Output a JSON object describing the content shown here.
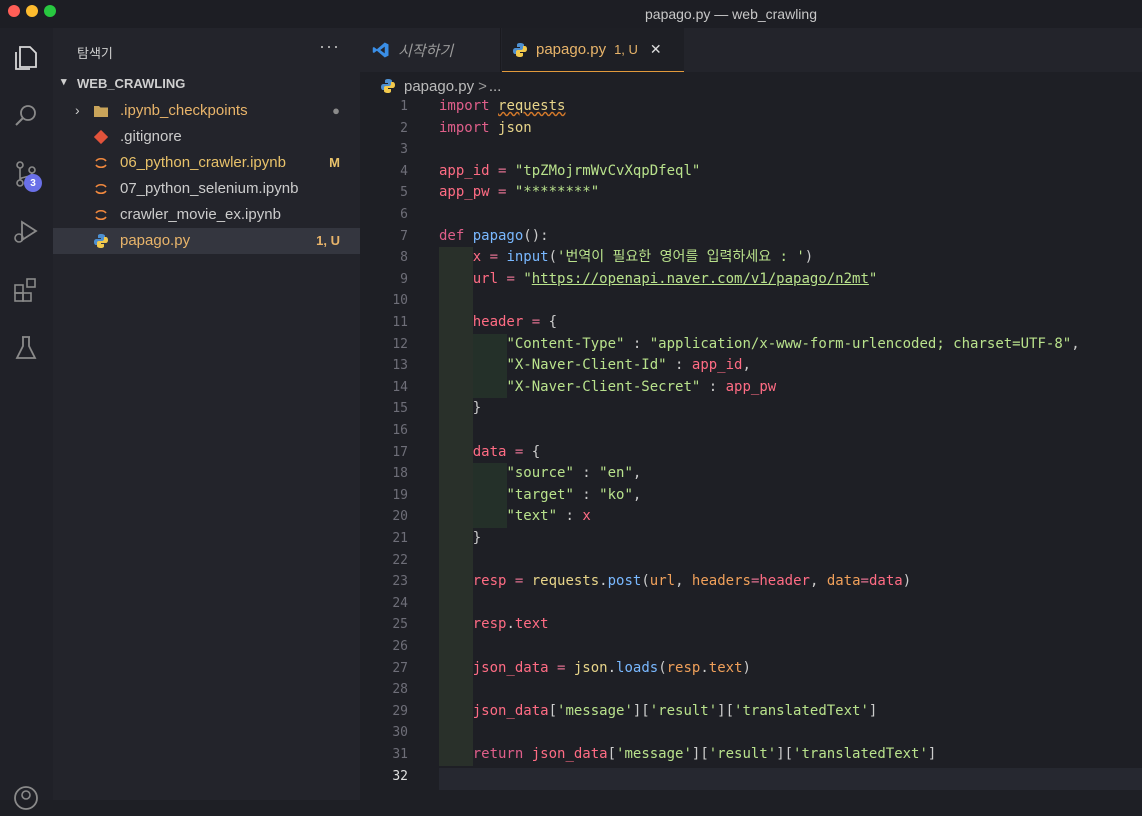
{
  "window": {
    "title": "papago.py — web_crawling"
  },
  "activity_bar": {
    "scm_badge": "3"
  },
  "sidebar": {
    "title": "탐색기",
    "more": "···",
    "folder": "WEB_CRAWLING",
    "items": [
      {
        "name": ".ipynb_checkpoints",
        "status": "●",
        "kind": "folder",
        "color": "#e8b46a",
        "status_color": "#8a8a8a"
      },
      {
        "name": ".gitignore",
        "status": "",
        "kind": "git",
        "color": "#cccccc",
        "status_color": "#cccccc"
      },
      {
        "name": "06_python_crawler.ipynb",
        "status": "M",
        "kind": "jupyter",
        "color": "#e8c26a",
        "status_color": "#e8c26a"
      },
      {
        "name": "07_python_selenium.ipynb",
        "status": "",
        "kind": "jupyter",
        "color": "#cccccc",
        "status_color": "#cccccc"
      },
      {
        "name": "crawler_movie_ex.ipynb",
        "status": "",
        "kind": "jupyter",
        "color": "#cccccc",
        "status_color": "#cccccc"
      },
      {
        "name": "papago.py",
        "status": "1, U",
        "kind": "python",
        "color": "#e8b46a",
        "status_color": "#e8b46a"
      }
    ]
  },
  "tabs": [
    {
      "label": "시작하기",
      "icon": "vscode-icon"
    },
    {
      "label": "papago.py",
      "status": "1, U",
      "icon": "python-icon",
      "close": "✕"
    }
  ],
  "breadcrumb": {
    "file": "papago.py",
    "separator": ">",
    "more": "..."
  },
  "editor": {
    "current_line": 32,
    "lines": [
      [
        [
          "import ",
          "kw"
        ],
        [
          "requests",
          "mod squig"
        ]
      ],
      [
        [
          "import ",
          "kw"
        ],
        [
          "json",
          "mod"
        ]
      ],
      [],
      [
        [
          "app_id",
          "var"
        ],
        [
          " = ",
          "op"
        ],
        [
          "\"tpZMojrmWvCvXqpDfeql\"",
          "str"
        ]
      ],
      [
        [
          "app_pw",
          "var"
        ],
        [
          " = ",
          "op"
        ],
        [
          "\"********\"",
          "str"
        ]
      ],
      [],
      [
        [
          "def ",
          "kw"
        ],
        [
          "papago",
          "fn"
        ],
        [
          "():",
          "punc"
        ]
      ],
      [
        [
          "    ",
          "punc"
        ],
        [
          "x",
          "var"
        ],
        [
          " = ",
          "op"
        ],
        [
          "input",
          "fn"
        ],
        [
          "(",
          "punc"
        ],
        [
          "'번역이 필요한 영어를 입력하세요 : '",
          "str"
        ],
        [
          ")",
          "punc"
        ]
      ],
      [
        [
          "    ",
          "punc"
        ],
        [
          "url",
          "var"
        ],
        [
          " = ",
          "op"
        ],
        [
          "\"",
          "str"
        ],
        [
          "https://openapi.naver.com/v1/papago/n2mt",
          "str ul"
        ],
        [
          "\"",
          "str"
        ]
      ],
      [],
      [
        [
          "    ",
          "punc"
        ],
        [
          "header",
          "var"
        ],
        [
          " = ",
          "op"
        ],
        [
          "{",
          "punc"
        ]
      ],
      [
        [
          "        ",
          "punc"
        ],
        [
          "\"Content-Type\"",
          "str"
        ],
        [
          " : ",
          "punc"
        ],
        [
          "\"application/x-www-form-urlencoded; charset=UTF-8\"",
          "str"
        ],
        [
          ",",
          "punc"
        ]
      ],
      [
        [
          "        ",
          "punc"
        ],
        [
          "\"X-Naver-Client-Id\"",
          "str"
        ],
        [
          " : ",
          "punc"
        ],
        [
          "app_id",
          "var"
        ],
        [
          ",",
          "punc"
        ]
      ],
      [
        [
          "        ",
          "punc"
        ],
        [
          "\"X-Naver-Client-Secret\"",
          "str"
        ],
        [
          " : ",
          "punc"
        ],
        [
          "app_pw",
          "var"
        ]
      ],
      [
        [
          "    ",
          "punc"
        ],
        [
          "}",
          "punc"
        ]
      ],
      [],
      [
        [
          "    ",
          "punc"
        ],
        [
          "data",
          "var"
        ],
        [
          " = ",
          "op"
        ],
        [
          "{",
          "punc"
        ]
      ],
      [
        [
          "        ",
          "punc"
        ],
        [
          "\"source\"",
          "str"
        ],
        [
          " : ",
          "punc"
        ],
        [
          "\"en\"",
          "str"
        ],
        [
          ",",
          "punc"
        ]
      ],
      [
        [
          "        ",
          "punc"
        ],
        [
          "\"target\"",
          "str"
        ],
        [
          " : ",
          "punc"
        ],
        [
          "\"ko\"",
          "str"
        ],
        [
          ",",
          "punc"
        ]
      ],
      [
        [
          "        ",
          "punc"
        ],
        [
          "\"text\"",
          "str"
        ],
        [
          " : ",
          "punc"
        ],
        [
          "x",
          "var"
        ]
      ],
      [
        [
          "    ",
          "punc"
        ],
        [
          "}",
          "punc"
        ]
      ],
      [],
      [
        [
          "    ",
          "punc"
        ],
        [
          "resp",
          "var"
        ],
        [
          " = ",
          "op"
        ],
        [
          "requests",
          "mod"
        ],
        [
          ".",
          "punc"
        ],
        [
          "post",
          "fn"
        ],
        [
          "(",
          "punc"
        ],
        [
          "url",
          "param"
        ],
        [
          ", ",
          "punc"
        ],
        [
          "headers",
          "param"
        ],
        [
          "=",
          "op"
        ],
        [
          "header",
          "var"
        ],
        [
          ", ",
          "punc"
        ],
        [
          "data",
          "param"
        ],
        [
          "=",
          "op"
        ],
        [
          "data",
          "var"
        ],
        [
          ")",
          "punc"
        ]
      ],
      [],
      [
        [
          "    ",
          "punc"
        ],
        [
          "resp",
          "var"
        ],
        [
          ".",
          "punc"
        ],
        [
          "text",
          "var"
        ]
      ],
      [],
      [
        [
          "    ",
          "punc"
        ],
        [
          "json_data",
          "var"
        ],
        [
          " = ",
          "op"
        ],
        [
          "json",
          "mod"
        ],
        [
          ".",
          "punc"
        ],
        [
          "loads",
          "fn"
        ],
        [
          "(",
          "punc"
        ],
        [
          "resp",
          "param"
        ],
        [
          ".",
          "punc"
        ],
        [
          "text",
          "param"
        ],
        [
          ")",
          "punc"
        ]
      ],
      [],
      [
        [
          "    ",
          "punc"
        ],
        [
          "json_data",
          "var"
        ],
        [
          "[",
          "punc"
        ],
        [
          "'message'",
          "str"
        ],
        [
          "][",
          "punc"
        ],
        [
          "'result'",
          "str"
        ],
        [
          "][",
          "punc"
        ],
        [
          "'translatedText'",
          "str"
        ],
        [
          "]",
          "punc"
        ]
      ],
      [],
      [
        [
          "    ",
          "punc"
        ],
        [
          "return ",
          "kw"
        ],
        [
          "json_data",
          "var"
        ],
        [
          "[",
          "punc"
        ],
        [
          "'message'",
          "str"
        ],
        [
          "][",
          "punc"
        ],
        [
          "'result'",
          "str"
        ],
        [
          "][",
          "punc"
        ],
        [
          "'translatedText'",
          "str"
        ],
        [
          "]",
          "punc"
        ]
      ],
      []
    ]
  }
}
